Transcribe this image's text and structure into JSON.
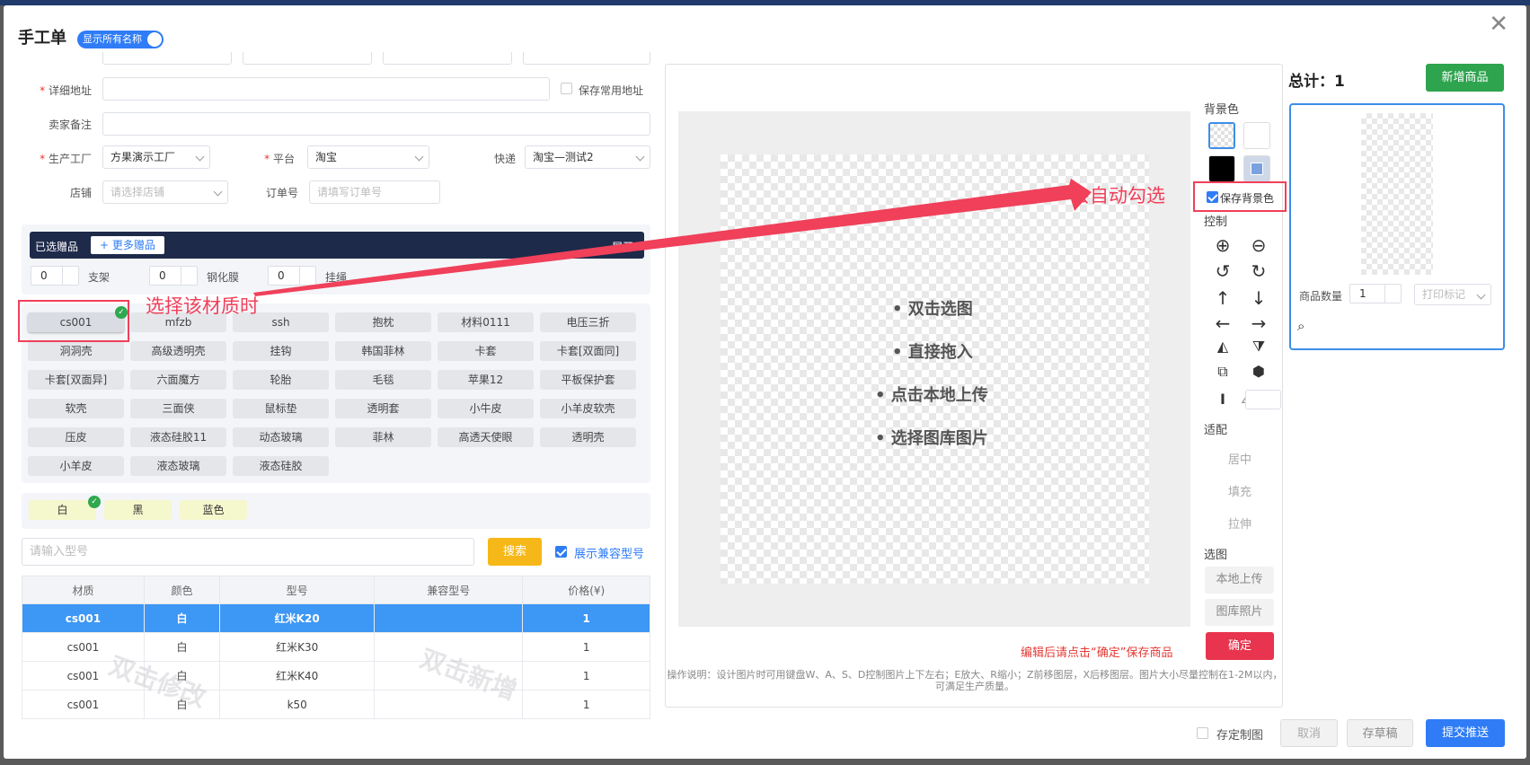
{
  "dialog": {
    "title": "手工单",
    "toggle_label": "显示所有名称"
  },
  "form": {
    "address_label": "详细地址",
    "save_address_label": "保存常用地址",
    "seller_note_label": "卖家备注",
    "factory_label": "生产工厂",
    "factory_value": "方果演示工厂",
    "platform_label": "平台",
    "platform_value": "淘宝",
    "express_label": "快递",
    "express_value": "淘宝—测试2",
    "shop_label": "店铺",
    "shop_placeholder": "请选择店铺",
    "order_label": "订单号",
    "order_placeholder": "请填写订单号"
  },
  "gifts": {
    "title": "已选赠品",
    "more_button": "+ 更多赠品",
    "expand_label": "展开",
    "items": [
      {
        "qty": "0",
        "name": "支架"
      },
      {
        "qty": "0",
        "name": "钢化膜"
      },
      {
        "qty": "0",
        "name": "挂绳"
      }
    ]
  },
  "materials": [
    "cs001",
    "mfzb",
    "ssh",
    "抱枕",
    "材料0111",
    "电压三折",
    "洞洞壳",
    "高级透明壳",
    "挂钩",
    "韩国菲林",
    "卡套",
    "卡套[双面同]",
    "卡套[双面异]",
    "六面魔方",
    "轮胎",
    "毛毯",
    "苹果12",
    "平板保护套",
    "软壳",
    "三面侠",
    "鼠标垫",
    "透明套",
    "小牛皮",
    "小羊皮软壳",
    "压皮",
    "液态硅胶11",
    "动态玻璃",
    "菲林",
    "高透天使眼",
    "透明壳",
    "小羊皮",
    "液态玻璃",
    "液态硅胶"
  ],
  "colors": [
    "白",
    "黑",
    "蓝色"
  ],
  "search": {
    "placeholder": "请输入型号",
    "button": "搜索",
    "compat_label": "展示兼容型号"
  },
  "table": {
    "headers": [
      "材质",
      "颜色",
      "型号",
      "兼容型号",
      "价格(¥)"
    ],
    "rows": [
      [
        "cs001",
        "白",
        "红米K20",
        "",
        "1"
      ],
      [
        "cs001",
        "白",
        "红米K30",
        "",
        "1"
      ],
      [
        "cs001",
        "白",
        "红米K40",
        "",
        "1"
      ],
      [
        "cs001",
        "白",
        "k50",
        "",
        "1"
      ]
    ],
    "watermark_left": "双击修改",
    "watermark_right": "双击新增"
  },
  "canvas": {
    "hints": [
      "• 双击选图",
      "• 直接拖入",
      "• 点击本地上传",
      "• 选择图库图片"
    ],
    "bg_label": "背景色",
    "save_bg_label": "保存背景色",
    "control_label": "控制",
    "fit_label": "适配",
    "fit_options": [
      "居中",
      "填充",
      "拉伸"
    ],
    "pick_label": "选图",
    "upload_button": "本地上传",
    "gallery_button": "图库照片",
    "confirm_button": "确定",
    "confirm_note": "编辑后请点击“确定”保存商品",
    "help_text": "操作说明：设计图片时可用键盘W、A、S、D控制图片上下左右；E放大、R缩小；Z前移图层，X后移图层。图片大小尽量控制在1-2M以内，可满足生产质量。"
  },
  "summary": {
    "total_label": "总计：1",
    "add_button": "新增商品",
    "qty_label": "商品数量",
    "qty_value": "1",
    "print_mark_placeholder": "打印标记"
  },
  "footer": {
    "save_design_label": "存定制图",
    "cancel_button": "取消",
    "draft_button": "存草稿",
    "submit_button": "提交推送"
  },
  "annotations": {
    "select_material": "选择该材质时",
    "auto_check": "会自动勾选"
  },
  "theme": {
    "primary": "#2f7cf6",
    "danger": "#e8344e",
    "success": "#2ea44f",
    "annotation": "#f0405a"
  }
}
